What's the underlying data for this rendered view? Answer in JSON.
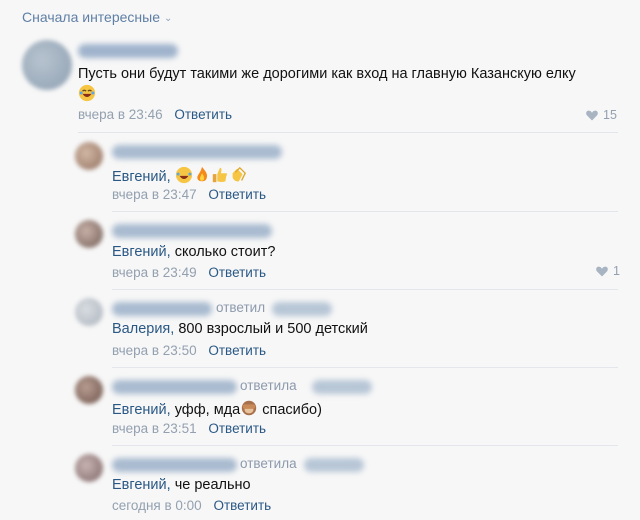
{
  "sort": {
    "label": "Сначала интересные"
  },
  "comments": [
    {
      "text": "Пусть они будут такими же дорогими как вход на главную Казанскую елку",
      "time": "вчера в 23:46",
      "reply": "Ответить",
      "likes": "15"
    },
    {
      "mention": "Евгений,",
      "time": "вчера в 23:47",
      "reply": "Ответить"
    },
    {
      "mention": "Евгений,",
      "text": "сколько стоит?",
      "time": "вчера в 23:49",
      "reply": "Ответить",
      "likes": "1"
    },
    {
      "replied": "ответил",
      "mention": "Валерия,",
      "text": "800 взрослый и 500 детский",
      "time": "вчера в 23:50",
      "reply": "Ответить"
    },
    {
      "replied": "ответила",
      "mention": "Евгений,",
      "text_a": "уфф, мда",
      "text_b": "спасибо)",
      "time": "вчера в 23:51",
      "reply": "Ответить"
    },
    {
      "replied": "ответила",
      "mention": "Евгений,",
      "text": "че реально",
      "time": "сегодня в 0:00",
      "reply": "Ответить"
    }
  ]
}
